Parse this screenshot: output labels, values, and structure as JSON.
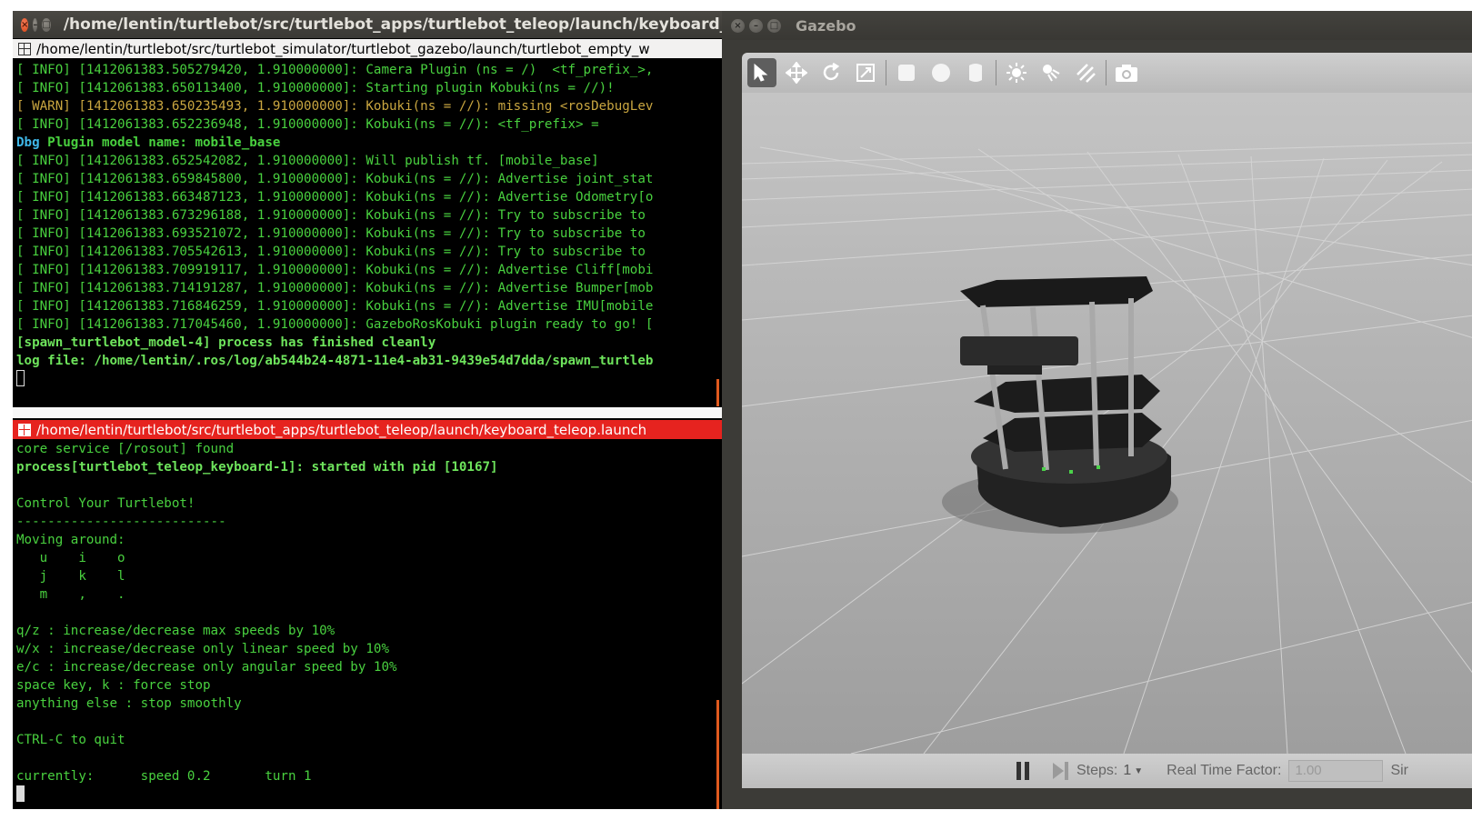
{
  "terminal": {
    "title": "/home/lentin/turtlebot/src/turtlebot_apps/turtlebot_teleop/launch/keyboard_t",
    "tab1_title": "/home/lentin/turtlebot/src/turtlebot_simulator/turtlebot_gazebo/launch/turtlebot_empty_w",
    "tab2_title": "/home/lentin/turtlebot/src/turtlebot_apps/turtlebot_teleop/launch/keyboard_teleop.launch",
    "top_lines": [
      {
        "kind": "info",
        "text": "[ INFO] [1412061383.505279420, 1.910000000]: Camera Plugin (ns = /)  <tf_prefix_>,"
      },
      {
        "kind": "info",
        "text": "[ INFO] [1412061383.650113400, 1.910000000]: Starting plugin Kobuki(ns = //)!"
      },
      {
        "kind": "warn",
        "text": "[ WARN] [1412061383.650235493, 1.910000000]: Kobuki(ns = //): missing <rosDebugLev"
      },
      {
        "kind": "info",
        "text": "[ INFO] [1412061383.652236948, 1.910000000]: Kobuki(ns = //): <tf_prefix> ="
      },
      {
        "kind": "dbg",
        "text": "Dbg",
        "rest": " Plugin model name: mobile_base"
      },
      {
        "kind": "info",
        "text": "[ INFO] [1412061383.652542082, 1.910000000]: Will publish tf. [mobile_base]"
      },
      {
        "kind": "info",
        "text": "[ INFO] [1412061383.659845800, 1.910000000]: Kobuki(ns = //): Advertise joint_stat"
      },
      {
        "kind": "info",
        "text": "[ INFO] [1412061383.663487123, 1.910000000]: Kobuki(ns = //): Advertise Odometry[o"
      },
      {
        "kind": "info",
        "text": "[ INFO] [1412061383.673296188, 1.910000000]: Kobuki(ns = //): Try to subscribe to"
      },
      {
        "kind": "info",
        "text": "[ INFO] [1412061383.693521072, 1.910000000]: Kobuki(ns = //): Try to subscribe to"
      },
      {
        "kind": "info",
        "text": "[ INFO] [1412061383.705542613, 1.910000000]: Kobuki(ns = //): Try to subscribe to"
      },
      {
        "kind": "info",
        "text": "[ INFO] [1412061383.709919117, 1.910000000]: Kobuki(ns = //): Advertise Cliff[mobi"
      },
      {
        "kind": "info",
        "text": "[ INFO] [1412061383.714191287, 1.910000000]: Kobuki(ns = //): Advertise Bumper[mob"
      },
      {
        "kind": "info",
        "text": "[ INFO] [1412061383.716846259, 1.910000000]: Kobuki(ns = //): Advertise IMU[mobile"
      },
      {
        "kind": "info",
        "text": "[ INFO] [1412061383.717045460, 1.910000000]: GazeboRosKobuki plugin ready to go! ["
      },
      {
        "kind": "bold",
        "text": "[spawn_turtlebot_model-4] process has finished cleanly"
      },
      {
        "kind": "bold",
        "text": "log file: /home/lentin/.ros/log/ab544b24-4871-11e4-ab31-9439e54d7dda/spawn_turtleb"
      }
    ],
    "bottom_lines": [
      {
        "kind": "plain",
        "text": "core service [/rosout] found"
      },
      {
        "kind": "bold",
        "text": "process[turtlebot_teleop_keyboard-1]: started with pid [10167]"
      },
      {
        "kind": "plain",
        "text": ""
      },
      {
        "kind": "plain",
        "text": "Control Your Turtlebot!"
      },
      {
        "kind": "plain",
        "text": "---------------------------"
      },
      {
        "kind": "plain",
        "text": "Moving around:"
      },
      {
        "kind": "plain",
        "text": "   u    i    o"
      },
      {
        "kind": "plain",
        "text": "   j    k    l"
      },
      {
        "kind": "plain",
        "text": "   m    ,    ."
      },
      {
        "kind": "plain",
        "text": ""
      },
      {
        "kind": "plain",
        "text": "q/z : increase/decrease max speeds by 10%"
      },
      {
        "kind": "plain",
        "text": "w/x : increase/decrease only linear speed by 10%"
      },
      {
        "kind": "plain",
        "text": "e/c : increase/decrease only angular speed by 10%"
      },
      {
        "kind": "plain",
        "text": "space key, k : force stop"
      },
      {
        "kind": "plain",
        "text": "anything else : stop smoothly"
      },
      {
        "kind": "plain",
        "text": ""
      },
      {
        "kind": "plain",
        "text": "CTRL-C to quit"
      },
      {
        "kind": "plain",
        "text": ""
      },
      {
        "kind": "plain",
        "text": "currently:      speed 0.2       turn 1"
      }
    ]
  },
  "gazebo": {
    "title": "Gazebo",
    "toolbar_icons": [
      "select-arrow-icon",
      "translate-icon",
      "rotate-icon",
      "scale-icon",
      "box-icon",
      "sphere-icon",
      "cylinder-icon",
      "point-light-icon",
      "spot-light-icon",
      "directional-light-icon",
      "screenshot-icon"
    ],
    "steps_label": "Steps:",
    "steps_value": "1",
    "rtf_label": "Real Time Factor:",
    "rtf_value": "1.00",
    "sim_label": "Sir"
  },
  "colors": {
    "terminal_bg": "#000000",
    "info_green": "#49d13f",
    "warn_yellow": "#c9a640",
    "dbg_cyan": "#3fb7e8",
    "active_tab_red": "#e6231f",
    "gazebo_floor": "#b4b4b4"
  }
}
